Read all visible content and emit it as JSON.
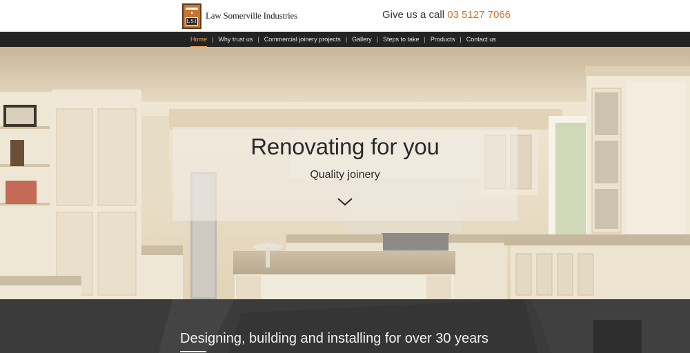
{
  "header": {
    "logo_text": "Law Somerville Industries",
    "logo_mark": "LSI",
    "call_prefix": "Give us a call",
    "phone": "03 5127 7066"
  },
  "nav": {
    "items": [
      {
        "label": "Home",
        "active": true
      },
      {
        "label": "Why trust us"
      },
      {
        "label": "Commercial joinery projects"
      },
      {
        "label": "Gallery"
      },
      {
        "label": "Steps to take"
      },
      {
        "label": "Products"
      },
      {
        "label": "Contact us"
      }
    ],
    "separator": "|"
  },
  "hero": {
    "title": "Renovating for you",
    "subtitle": "Quality joinery",
    "scroll_icon": "chevron-down-icon"
  },
  "band": {
    "title": "Designing, building and installing for over 30 years"
  },
  "colors": {
    "accent": "#c9732c",
    "nav_bg": "#232323",
    "band_bg": "#3a3a3a"
  }
}
